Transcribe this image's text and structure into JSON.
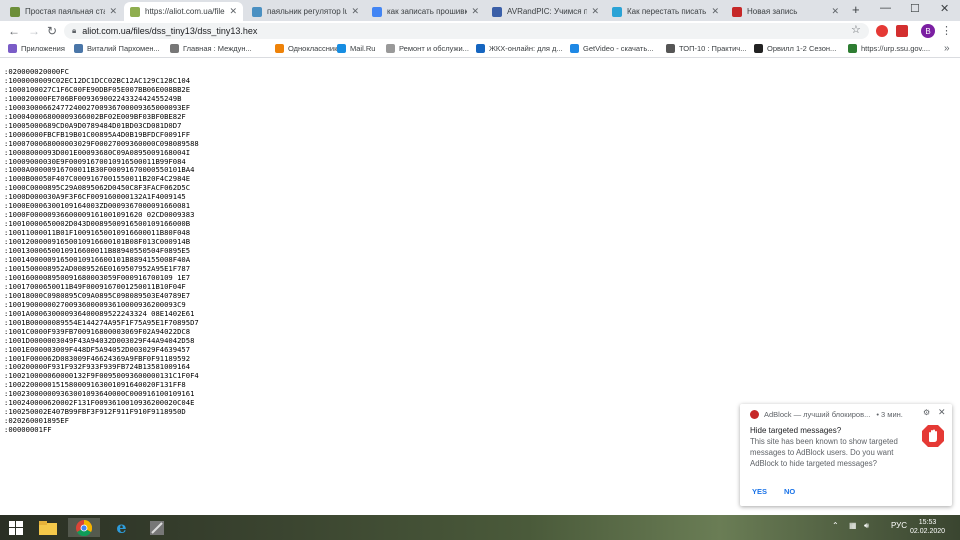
{
  "window": {
    "new_tab": "+",
    "minimize": "—",
    "maximize": "☐",
    "close": "✕"
  },
  "tabs": [
    {
      "label": "Простая паяльная станц",
      "active": false,
      "color": "#6d8f3a"
    },
    {
      "label": "https://aliot.com.ua/files/",
      "active": true,
      "color": "#8fae4f"
    },
    {
      "label": "паяльник регулятор lusko",
      "active": false,
      "color": "#4a90c2"
    },
    {
      "label": "как записать прошивку в",
      "active": false,
      "color": "#4285f4"
    },
    {
      "label": "AVRandPIC: Учимся прог",
      "active": false,
      "color": "#3b5fa8"
    },
    {
      "label": "Как перестать писать пр",
      "active": false,
      "color": "#2aa3d6"
    },
    {
      "label": "Новая запись",
      "active": false,
      "color": "#c62828"
    }
  ],
  "toolbar": {
    "url": "aliot.com.ua/files/dss_tiny13/dss_tiny13.hex",
    "avatar_letter": "B"
  },
  "bookmarks": [
    {
      "label": "Приложения",
      "color": "#7a5cc7"
    },
    {
      "label": "Виталий Пархомен...",
      "color": "#4a76a8"
    },
    {
      "label": "Главная : Междун...",
      "color": "#777777"
    },
    {
      "label": "Одноклассники",
      "color": "#ee8208"
    },
    {
      "label": "Mail.Ru",
      "color": "#168de2"
    },
    {
      "label": "Ремонт и обслужи...",
      "color": "#999999"
    },
    {
      "label": "ЖКХ-онлайн: для д...",
      "color": "#1565c0"
    },
    {
      "label": "GetVideo - скачать...",
      "color": "#1e88e5"
    },
    {
      "label": "ТОП-10 : Практич...",
      "color": "#555555"
    },
    {
      "label": "Орвилл 1-2 Сезон...",
      "color": "#222222"
    },
    {
      "label": "https://urp.ssu.gov....",
      "color": "#2e7d32"
    }
  ],
  "hex_lines": [
    ":020000020000FC",
    ":1000000009C02EC12DC1DCC02BC12AC129C128C104",
    ":1000100027C1F6C00FE90DBF05E007BB06E008BB2E",
    ":100020000FE706BF0093690022433244245524​9B",
    ":1000300066247724002700936700009365000093EF",
    ":100040006800009366002BF02E009BF03BF0BE82F",
    ":10005000689CD0A9D0789484D01BD03CD081D0D7",
    ":10006000FBCFB19B01C00895A4D0B19BFDCF0091FF",
    ":1000700068000003029F00027009360000C098089588",
    ":10008000093D001E00093680C09A0895009168004I",
    ":10009000030E9F00091670010916500011B99F084",
    ":1000A00000916700011B30F00091670000550101BA4",
    ":1000B00050F407C0009167001550011B20F4C2984E",
    ":1000C0000895C29A0895062D0450C8F3FACF062D5C",
    ":1000D000030A9F3F6CF009160000132A1F4009145",
    ":1000E0006300109164003ZD0009367000091660081",
    ":1000F00000936600009161001091620 02CD0009383",
    ":10010000650002D043D0089500916500109166000B",
    ":10011000011B01F10091650010916600011B80F048",
    ":100120000091650010916600101B08F013C000914B",
    ":10013000650010916600011B88940550504F0895E5",
    ":100140000091650010916600101B8894155008F40A",
    ":1001500008952AD0089526E0169507952A95E1F787",
    ":1001600008950091680003059F000916700109 1E7",
    ":10017000650011B49F0009167001250011B10F04F",
    ":10018000C0980895C09A0895C098089503E40789E7",
    ":100190000002700936000093610000936200093C9",
    ":1001A000630000936400089522243324 08E1402E61",
    ":1001B00000089554E144274A95F1F75A95E1F70895D7",
    ":1001C0000F939FB700916800003069F02A94022DC8",
    ":1001D0000003049F43A94032D003029F44A94042D58",
    ":1001E000003009F448DF5A94052D003029F4639457",
    ":1001F000062D083009F46624369A9FBF0F91189592",
    ":100200000F931F932F933F939FB724B13581009164",
    ":100210000060000132F9F00950093600000131C1F0F4",
    ":1002200000151580009163001091640020F131FF8",
    ":100230000009363001093640000C000916100109161",
    ":100240000620002F131F0093610010936200020C04E",
    ":100250002E407B99FBF3F912F911F910F9118950D",
    ":020260001895EF",
    ":00000001FF"
  ],
  "notification": {
    "app": "AdBlock — лучший блокиров...",
    "time": "• 3 мин.",
    "title": "Hide targeted messages?",
    "body": "This site has been known to show targeted messages to AdBlock users. Do you want AdBlock to hide targeted messages?",
    "yes": "YES",
    "no": "NO"
  },
  "taskbar": {
    "lang": "РУС",
    "time": "15:53",
    "date": "02.02.2020"
  }
}
